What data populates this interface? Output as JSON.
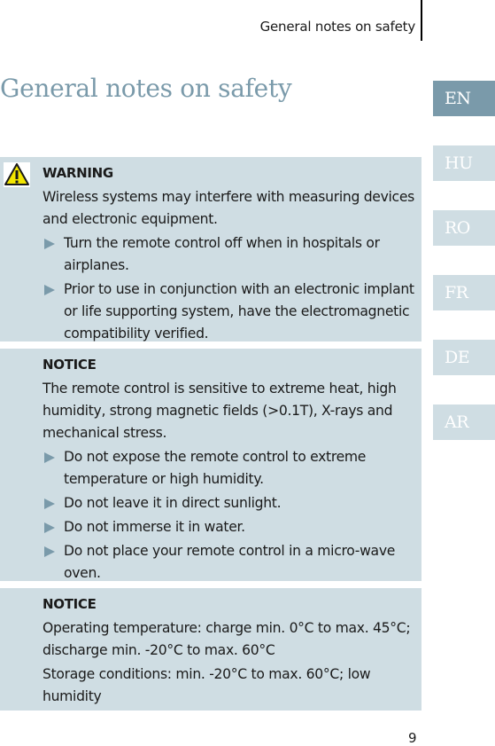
{
  "header": {
    "running_title": "General notes on safety"
  },
  "page_title": "General notes on safety",
  "language_tabs": [
    {
      "label": "EN",
      "active": true
    },
    {
      "label": "HU",
      "active": false
    },
    {
      "label": "RO",
      "active": false
    },
    {
      "label": "FR",
      "active": false
    },
    {
      "label": "DE",
      "active": false
    },
    {
      "label": "AR",
      "active": false
    }
  ],
  "boxes": {
    "warning": {
      "icon": "warning-triangle-icon",
      "heading": "WARNING",
      "paragraphs": [
        "Wireless systems may interfere with measuring devices and electronic equipment."
      ],
      "bullets": [
        "Turn the remote control off when in hospitals or airplanes.",
        "Prior to use in conjunction with an electronic implant or life supporting system, have the electromagnetic compatibility verified."
      ]
    },
    "notice1": {
      "heading": "NOTICE",
      "paragraphs": [
        "The remote control is sensitive to extreme heat, high humidity, strong magnetic fields (>0.1T), X-rays and mechanical stress."
      ],
      "bullets": [
        "Do not expose the remote control to extreme temperature or high humidity.",
        "Do not leave it in direct sunlight.",
        "Do not immerse it in water.",
        "Do not place your remote control in a micro-wave oven."
      ]
    },
    "notice2": {
      "heading": "NOTICE",
      "paragraphs": [
        "Operating temperature: charge min. 0°C to max. 45°C; discharge min. -20°C to max. 60°C",
        "Storage conditions: min. -20°C to max. 60°C; low humidity"
      ]
    }
  },
  "page_number": "9",
  "colors": {
    "accent": "#7a9aaa",
    "box_background": "#cfdde3",
    "warning_yellow": "#f2e600"
  }
}
